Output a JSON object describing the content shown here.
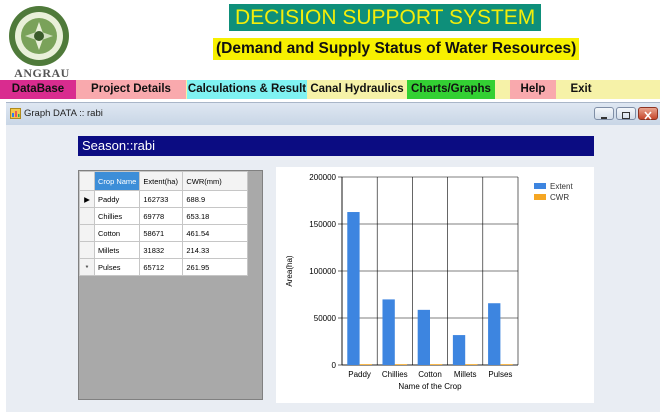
{
  "header": {
    "title": "DECISION SUPPORT SYSTEM",
    "subtitle": "(Demand and Supply Status of Water Resources)",
    "logo_text": "ANGRAU"
  },
  "menu": [
    {
      "label": "DataBase",
      "bg": "#d92c8f",
      "color": "#111111"
    },
    {
      "label": "Project Details",
      "bg": "#f9a9ad",
      "color": "#111111"
    },
    {
      "label": "Calculations & Result",
      "bg": "#7ff2f2",
      "color": "#111111"
    },
    {
      "label": "Canal Hydraulics",
      "bg": "#f6f2a8",
      "color": "#111111"
    },
    {
      "label": "Charts/Graphs",
      "bg": "#33d033",
      "color": "#111111"
    },
    {
      "label": "Help",
      "bg": "#f9a9ad",
      "color": "#111111"
    },
    {
      "label": "Exit",
      "bg": "#f6f2a8",
      "color": "#111111"
    }
  ],
  "window": {
    "title": "Graph DATA :: rabi",
    "season_label": "Season::rabi"
  },
  "grid": {
    "columns": [
      "Crop Name",
      "Extent(ha)",
      "CWR(mm)"
    ],
    "rows": [
      {
        "marker": "▶",
        "cells": [
          "Paddy",
          "162733",
          "688.9"
        ]
      },
      {
        "marker": "",
        "cells": [
          "Chillies",
          "69778",
          "653.18"
        ]
      },
      {
        "marker": "",
        "cells": [
          "Cotton",
          "58671",
          "461.54"
        ]
      },
      {
        "marker": "",
        "cells": [
          "Millets",
          "31832",
          "214.33"
        ]
      },
      {
        "marker": "*",
        "cells": [
          "Pulses",
          "65712",
          "261.95"
        ]
      }
    ]
  },
  "chart_data": {
    "type": "bar",
    "categories": [
      "Paddy",
      "Chillies",
      "Cotton",
      "Millets",
      "Pulses"
    ],
    "series": [
      {
        "name": "Extent",
        "values": [
          162733,
          69778,
          58671,
          31832,
          65712
        ],
        "color": "#3d85e0"
      },
      {
        "name": "CWR",
        "values": [
          688.9,
          653.18,
          461.54,
          214.33,
          261.95
        ],
        "color": "#f5a623"
      }
    ],
    "yticks": [
      "0",
      "50000",
      "100000",
      "150000",
      "200000"
    ],
    "ylim": [
      0,
      200000
    ],
    "xlabel": "Name of the Crop",
    "ylabel": "Area(ha)",
    "legend": "top-right",
    "grid": true
  }
}
